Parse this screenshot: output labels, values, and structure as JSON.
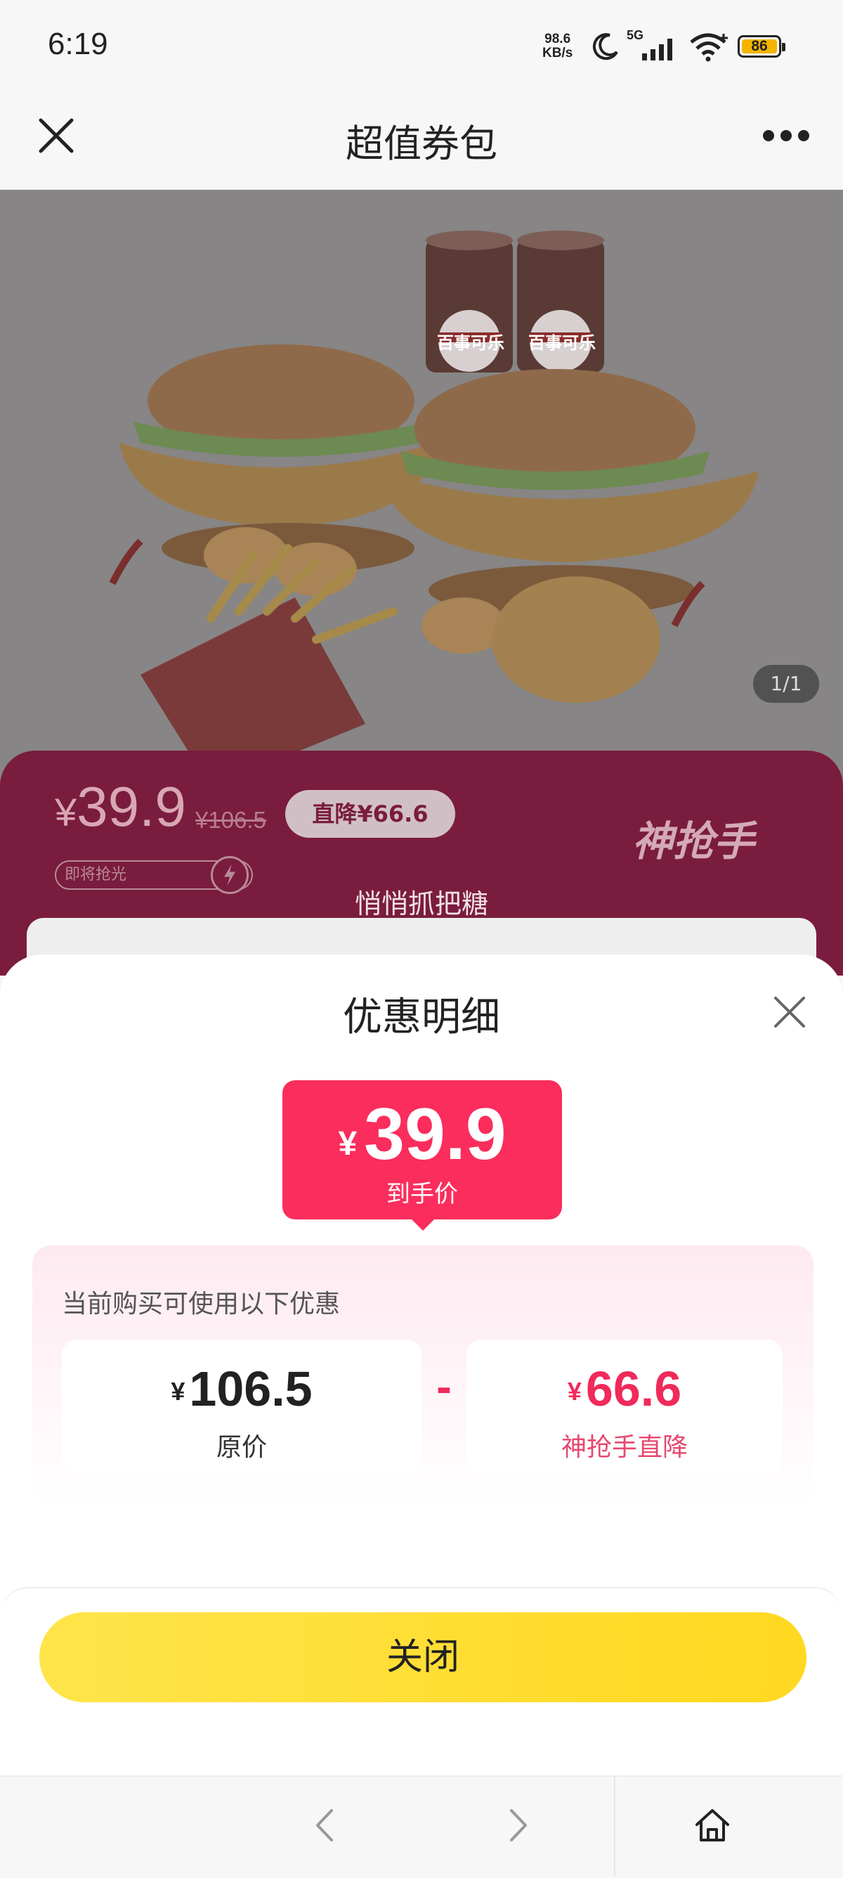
{
  "status_bar": {
    "time": "6:19",
    "net_speed_value": "98.6",
    "net_speed_unit": "KB/s",
    "network": "5G",
    "battery": "86",
    "icons": [
      "moon-icon",
      "signal-5g-icon",
      "wifi-icon",
      "battery-icon"
    ]
  },
  "navbar": {
    "title": "超值券包",
    "icons": [
      "close-icon",
      "more-icon"
    ]
  },
  "hero": {
    "image_counter": "1/1",
    "product_labels": [
      "百事可乐",
      "百事可乐"
    ]
  },
  "banner": {
    "currency": "¥",
    "price": "39.9",
    "original_price": "¥106.5",
    "drop_label": "直降¥66.6",
    "rush_label": "即将抢光",
    "brand": "神抢手",
    "promo_text": "悄悄抓把糖"
  },
  "sheet": {
    "title": "优惠明细",
    "final_price_currency": "¥",
    "final_price": "39.9",
    "final_price_label": "到手价",
    "hint": "当前购买可使用以下优惠",
    "original": {
      "currency": "¥",
      "value": "106.5",
      "label": "原价"
    },
    "operator": "-",
    "discount": {
      "currency": "¥",
      "value": "66.6",
      "label": "神抢手直降"
    },
    "close_button": "关闭"
  },
  "colors": {
    "accent": "#fb2d5c",
    "button_yellow": "#ffe033",
    "banner": "#7a1c3e"
  },
  "bottom_nav": {
    "icons": [
      "back-icon",
      "forward-icon",
      "home-icon"
    ]
  }
}
